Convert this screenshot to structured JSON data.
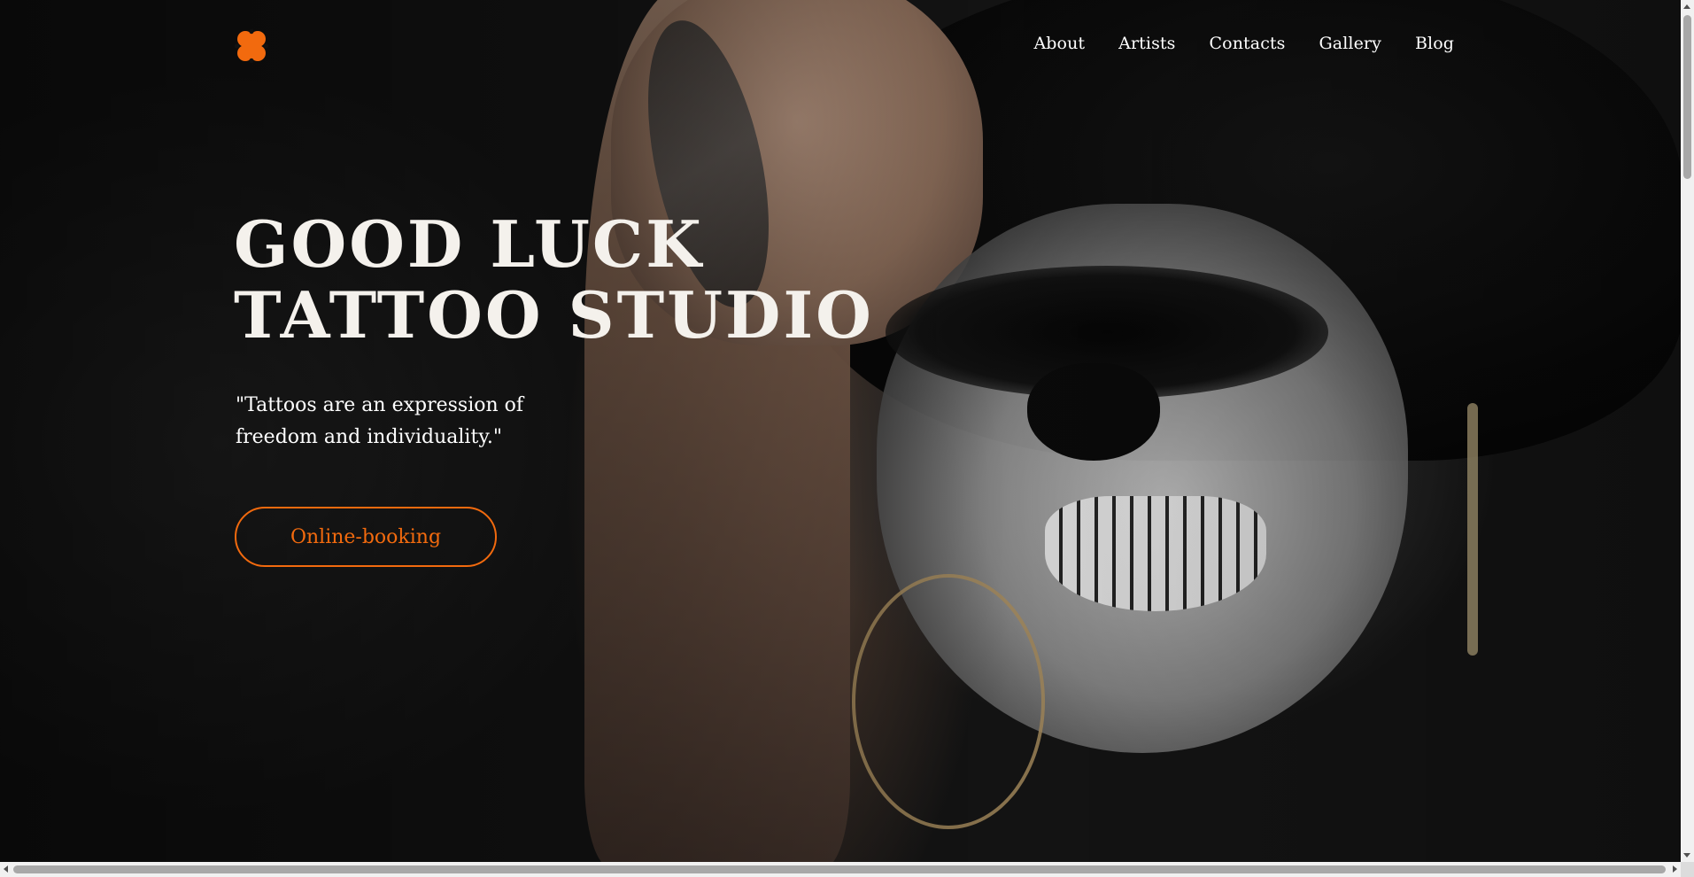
{
  "header": {
    "logo_icon": "four-leaf-clover-icon",
    "accent_color": "#f26a0e",
    "nav": [
      {
        "label": "About"
      },
      {
        "label": "Artists"
      },
      {
        "label": "Contacts"
      },
      {
        "label": "Gallery"
      },
      {
        "label": "Blog"
      }
    ]
  },
  "hero": {
    "title_line1": "GOOD LUCK",
    "title_line2": "TATTOO STUDIO",
    "quote": "\"Tattoos are an expression of freedom and individuality.\"",
    "cta_label": "Online-booking",
    "background_image": "tattooed-woman-skull-makeup-photo"
  }
}
